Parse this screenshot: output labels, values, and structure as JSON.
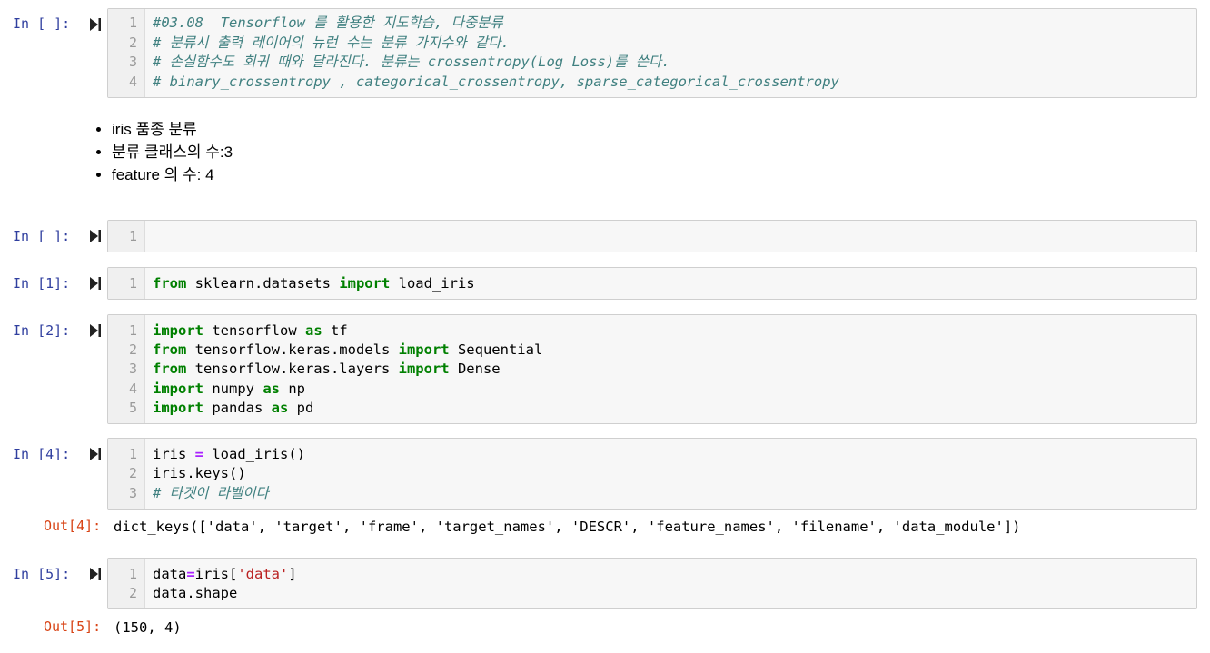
{
  "cells": {
    "c1": {
      "prompt": "In [ ]:",
      "lines": [
        "#03.08  Tensorflow 를 활용한 지도학습, 다중분류",
        "# 분류시 출력 레이어의 뉴런 수는 분류 가지수와 같다.",
        "# 손실함수도 회귀 때와 달라진다. 분류는 crossentropy(Log Loss)를 쓴다.",
        "# binary_crossentropy , categorical_crossentropy, sparse_categorical_crossentropy"
      ]
    },
    "markdown": {
      "items": [
        "iris 품종 분류",
        "분류 클래스의 수:3",
        "feature 의 수: 4"
      ]
    },
    "c2": {
      "prompt": "In [ ]:"
    },
    "c3": {
      "prompt": "In [1]:",
      "l1": {
        "k1": "from",
        "t1": " sklearn.datasets ",
        "k2": "import",
        "t2": " load_iris"
      }
    },
    "c4": {
      "prompt": "In [2]:",
      "l1": {
        "k1": "import",
        "t1": " tensorflow ",
        "k2": "as",
        "t2": " tf"
      },
      "l2": {
        "k1": "from",
        "t1": " tensorflow.keras.models ",
        "k2": "import",
        "t2": " Sequential"
      },
      "l3": {
        "k1": "from",
        "t1": " tensorflow.keras.layers ",
        "k2": "import",
        "t2": " Dense"
      },
      "l4": {
        "k1": "import",
        "t1": " numpy ",
        "k2": "as",
        "t2": " np"
      },
      "l5": {
        "k1": "import",
        "t1": " pandas ",
        "k2": "as",
        "t2": " pd"
      }
    },
    "c5": {
      "prompt": "In [4]:",
      "l1": {
        "a": "iris ",
        "op": "=",
        "b": " load_iris()"
      },
      "l2": "iris.keys()",
      "l3": "# 타겟이 라벨이다",
      "out_prompt": "Out[4]:",
      "output": "dict_keys(['data', 'target', 'frame', 'target_names', 'DESCR', 'feature_names', 'filename', 'data_module'])"
    },
    "c6": {
      "prompt": "In [5]:",
      "l1": {
        "a": "data",
        "op": "=",
        "b": "iris[",
        "s": "'data'",
        "c": "]"
      },
      "l2": "data.shape",
      "out_prompt": "Out[5]:",
      "output": "(150, 4)"
    }
  },
  "line_numbers": [
    "1",
    "2",
    "3",
    "4",
    "5"
  ],
  "colors": {
    "prompt": "#303f9f",
    "out_prompt": "#d84315",
    "keyword": "#008000",
    "comment": "#408080",
    "operator": "#aa22ff",
    "string": "#ba2121",
    "editor_bg": "#f7f7f7",
    "editor_border": "#cfcfcf"
  },
  "icons": {
    "run": "run-cell-icon"
  }
}
